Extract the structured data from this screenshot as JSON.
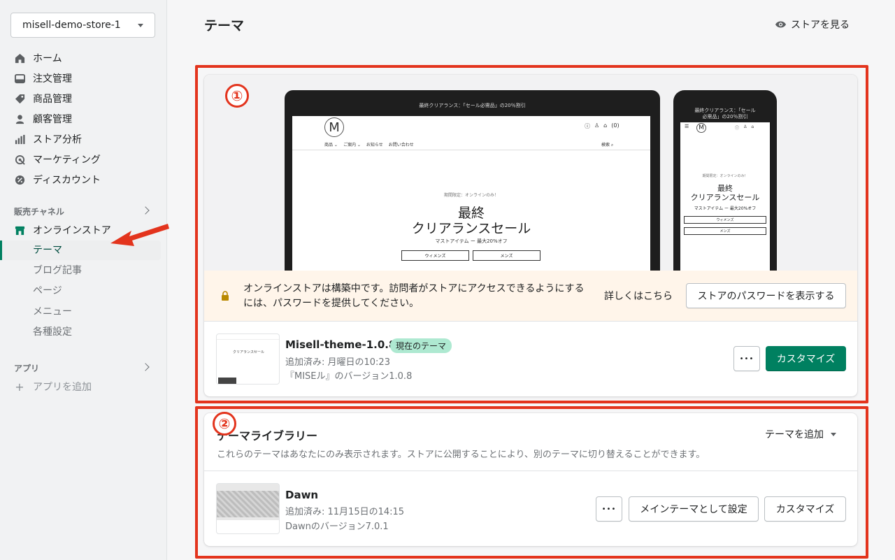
{
  "sidebar": {
    "store_name": "misell-demo-store-1",
    "nav": [
      {
        "label": "ホーム",
        "icon": "home-icon"
      },
      {
        "label": "注文管理",
        "icon": "orders-icon"
      },
      {
        "label": "商品管理",
        "icon": "tag-icon"
      },
      {
        "label": "顧客管理",
        "icon": "customer-icon"
      },
      {
        "label": "ストア分析",
        "icon": "analytics-icon"
      },
      {
        "label": "マーケティング",
        "icon": "marketing-icon"
      },
      {
        "label": "ディスカウント",
        "icon": "discount-icon"
      }
    ],
    "sales_channels_label": "販売チャネル",
    "online_store_label": "オンラインストア",
    "sub_items": [
      "テーマ",
      "ブログ記事",
      "ページ",
      "メニュー",
      "各種設定"
    ],
    "apps_label": "アプリ",
    "add_app_label": "アプリを追加"
  },
  "header": {
    "title": "テーマ",
    "view_store": "ストアを見る"
  },
  "current_theme": {
    "preview": {
      "laptop_announcement": "最終クリアランス：「セール必需品」の20％割引",
      "laptop_nav": [
        "商品 ⌄",
        "ご案内 ⌄",
        "お知らせ",
        "お問い合わせ"
      ],
      "laptop_search": "検索",
      "laptop_cart_count": "(0)",
      "hero_kicker": "期間限定：オンラインのみ！",
      "hero_line1": "最終",
      "hero_line2": "クリアランスセール",
      "hero_sub": "マストアイテム ー 最大20%オフ",
      "hero_btn_women": "ウィメンズ",
      "hero_btn_men": "メンズ",
      "phone_announcement": "最終クリアランス：「セール必需品」の20％割引",
      "phone_line1": "最終",
      "phone_line2": "クリアランスセール",
      "phone_sub": "マストアイテム ー 最大20%オフ"
    },
    "warning_text": "オンラインストアは構築中です。訪問者がストアにアクセスできるようにするには、パスワードを提供してください。",
    "learn_more": "詳しくはこちら",
    "show_password": "ストアのパスワードを表示する",
    "name": "Misell-theme-1.0.8",
    "badge": "現在のテーマ",
    "added": "追加済み: 月曜日の10:23",
    "version": "『MISEル』のバージョン1.0.8",
    "more": "•••",
    "customize": "カスタマイズ"
  },
  "library": {
    "title": "テーマライブラリー",
    "add_theme": "テーマを追加",
    "description": "これらのテーマはあなたにのみ表示されます。ストアに公開することにより、別のテーマに切り替えることができます。",
    "theme": {
      "name": "Dawn",
      "added": "追加済み: 11月15日の14:15",
      "version": "Dawnのバージョン7.0.1",
      "more": "•••",
      "publish": "メインテーマとして設定",
      "customize": "カスタマイズ"
    }
  },
  "annotations": {
    "label_1": "①",
    "label_2": "②"
  },
  "colors": {
    "primary": "#008060",
    "annotation_red": "#e3341d",
    "badge_green": "#aee9d1",
    "warning_bg": "#fff5ea"
  }
}
